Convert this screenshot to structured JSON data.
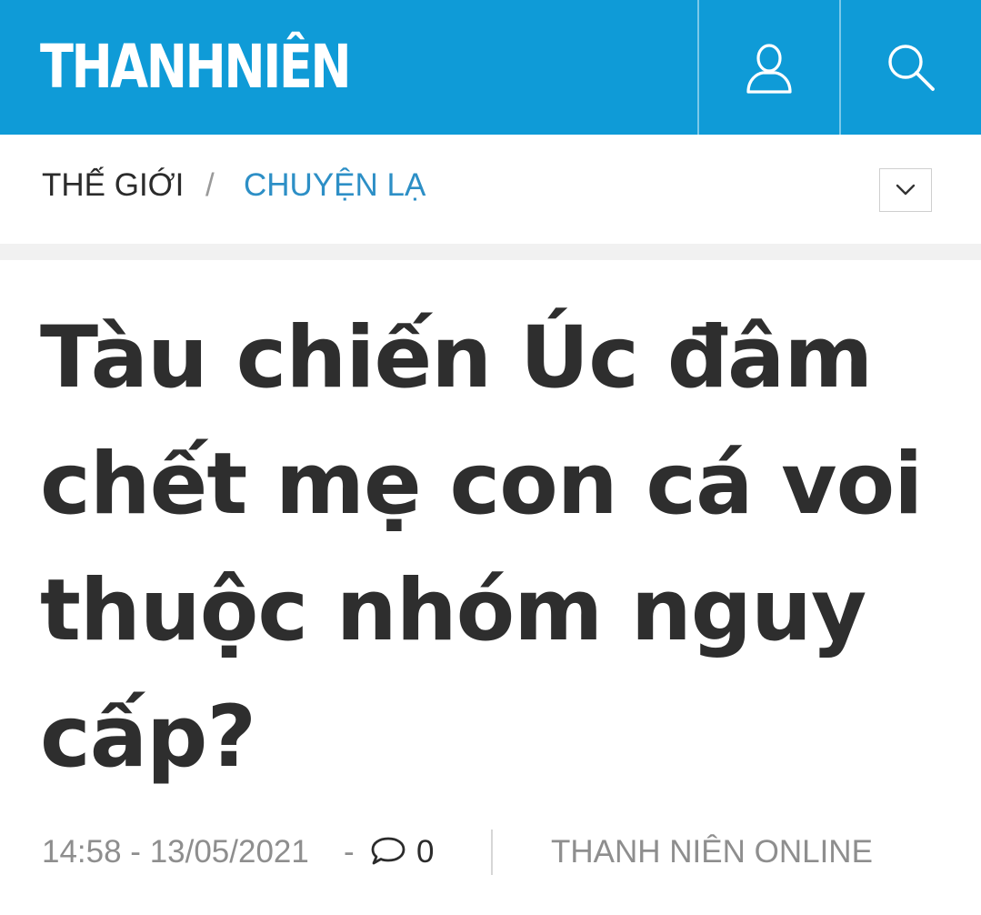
{
  "header": {
    "logo_text": "THANHNIÊN",
    "background_color": "#0f9bd7",
    "user_icon": "user-icon",
    "search_icon": "search-icon"
  },
  "breadcrumb": {
    "parent": "THẾ GIỚI",
    "separator": "/",
    "current": "CHUYỆN LẠ",
    "current_color": "#2d8fc6",
    "toggle_icon": "chevron-down-icon"
  },
  "article": {
    "headline": "Tàu chiến Úc đâm chết mẹ con cá voi thuộc nhóm nguy cấp?",
    "timestamp": "14:58 - 13/05/2021",
    "dash": "-",
    "comment_icon": "comment-icon",
    "comment_count": "0",
    "source": "THANH NIÊN ONLINE"
  }
}
